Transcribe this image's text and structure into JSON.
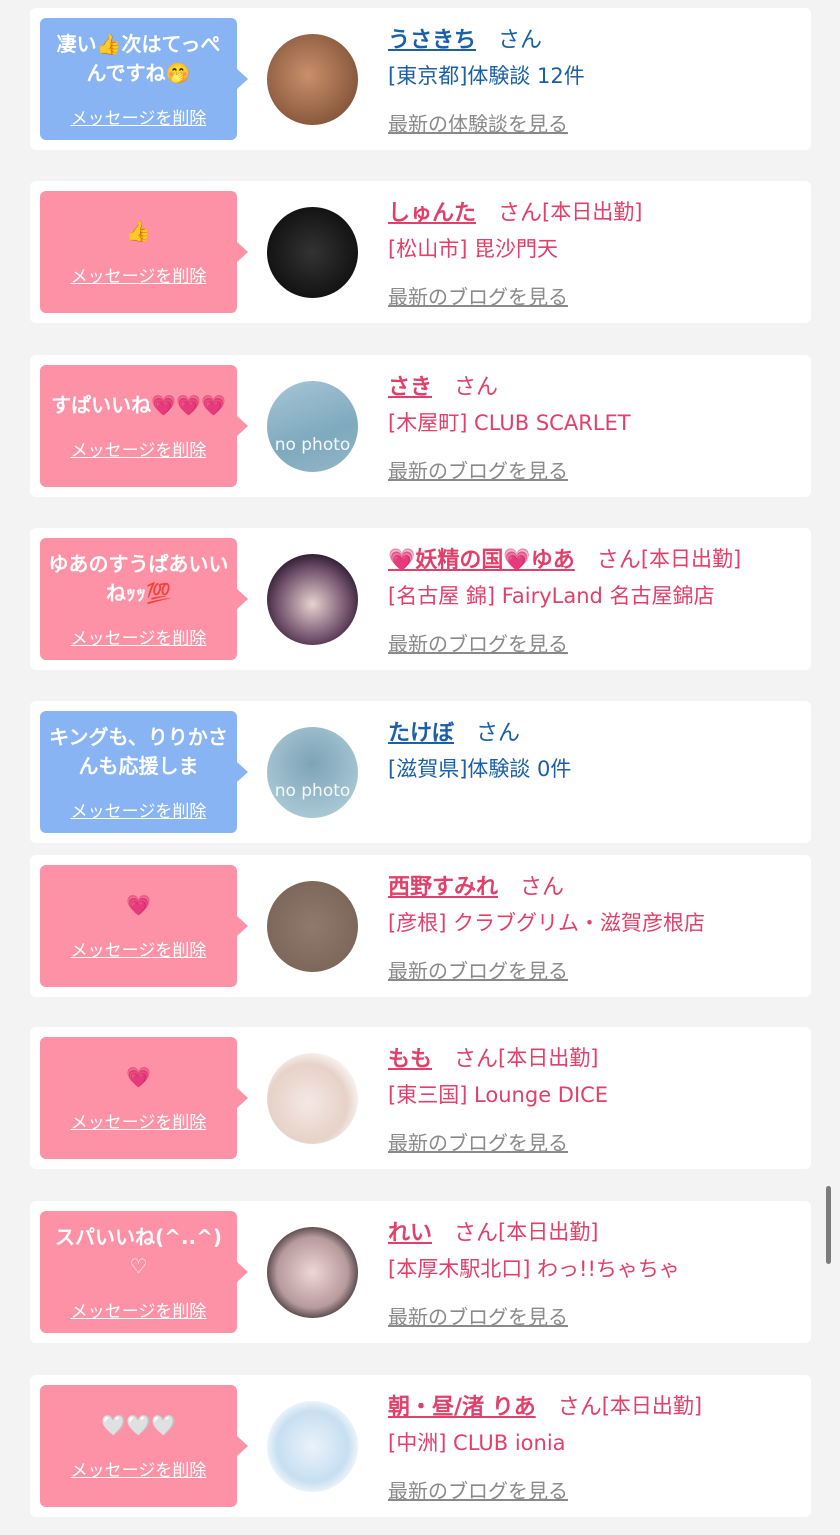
{
  "colors": {
    "background": "#f3f3f3",
    "bubble_blue": "#88b4f3",
    "bubble_pink": "#fd92a7",
    "text_blue": "#1b5fa8",
    "text_pink": "#e0406a",
    "link_gray": "#8a8a8a"
  },
  "entries": [
    {
      "theme": "blue",
      "message": "凄い👍次はてっぺんですね🤭",
      "delete_label": "メッセージを削除",
      "avatar": {
        "kind": "photo",
        "gradient": "radial-gradient(circle at 45% 45%, #c9906a, #8a5a3e 70%, #5b3a28)"
      },
      "name": "うさきち",
      "san": "さん",
      "status": "",
      "detail": "[東京都]体験談 12件",
      "more_label": "最新の体験談を見る"
    },
    {
      "theme": "pink",
      "message": "👍",
      "delete_label": "メッセージを削除",
      "avatar": {
        "kind": "logo",
        "gradient": "radial-gradient(circle at 50% 50%, #333, #111 75%)"
      },
      "name": "しゅんた",
      "san": "さん",
      "status": "[本日出勤]",
      "detail": "[松山市] 毘沙門天",
      "more_label": "最新のブログを見る"
    },
    {
      "theme": "pink",
      "message": "すぱいいね💗💗💗",
      "delete_label": "メッセージを削除",
      "avatar": {
        "kind": "nophoto",
        "text": "no photo",
        "gradient": "linear-gradient(160deg, #a6c6d6, #7fa9bd 60%, #93b6c6)"
      },
      "name": "さき",
      "san": "さん",
      "status": "",
      "detail": "[木屋町] CLUB SCARLET",
      "more_label": "最新のブログを見る"
    },
    {
      "theme": "pink",
      "message": "ゆあのすうぱあいいねｯｯ💯",
      "delete_label": "メッセージを削除",
      "avatar": {
        "kind": "photo",
        "gradient": "radial-gradient(circle at 50% 55%, #e8d2d0, #6b4a66 55%, #1d1320 80%)"
      },
      "name": "💗妖精の国💗ゆあ",
      "san": "さん",
      "status": "[本日出勤]",
      "detail": "[名古屋 錦] FairyLand 名古屋錦店",
      "more_label": "最新のブログを見る"
    },
    {
      "theme": "blue",
      "message": "キングも、りりかさんも応援しま",
      "delete_label": "メッセージを削除",
      "avatar": {
        "kind": "nophoto",
        "text": "no photo",
        "gradient": "radial-gradient(circle at 50% 40%, #7da4b6, #9fc0cf 60%, #b7d2dc)"
      },
      "name": "たけぼ",
      "san": "さん",
      "status": "",
      "detail": "[滋賀県]体験談 0件",
      "more_label": ""
    },
    {
      "theme": "pink",
      "message": "💗",
      "delete_label": "メッセージを削除",
      "avatar": {
        "kind": "logo",
        "gradient": "radial-gradient(circle, #8f7a6d, #7b6557 80%)"
      },
      "name": "西野すみれ",
      "san": "さん",
      "status": "",
      "detail": "[彦根] クラブグリム・滋賀彦根店",
      "more_label": "最新のブログを見る"
    },
    {
      "theme": "pink",
      "message": "💗",
      "delete_label": "メッセージを削除",
      "avatar": {
        "kind": "photo",
        "gradient": "radial-gradient(circle at 45% 55%, #f4e8e4, #e6d2c8 55%, #ffffff 80%)"
      },
      "name": "もも",
      "san": "さん",
      "status": "[本日出勤]",
      "detail": "[東三国] Lounge DICE",
      "more_label": "最新のブログを見る"
    },
    {
      "theme": "pink",
      "message": "スパいいね(^..^)♡",
      "delete_label": "メッセージを削除",
      "avatar": {
        "kind": "photo",
        "gradient": "radial-gradient(circle at 50% 50%, #efd6d6, #b79a9c 55%, #2b2326 80%)"
      },
      "name": "れい",
      "san": "さん",
      "status": "[本日出勤]",
      "detail": "[本厚木駅北口] わっ!!ちゃちゃ",
      "more_label": "最新のブログを見る"
    },
    {
      "theme": "pink",
      "message": "🤍🤍🤍",
      "delete_label": "メッセージを削除",
      "avatar": {
        "kind": "photo",
        "gradient": "radial-gradient(circle at 50% 50%, #eaf2fb, #c7dff1 55%, #ffffff 80%)"
      },
      "name": "朝・昼/渚 りあ",
      "san": "さん",
      "status": "[本日出勤]",
      "detail": "[中洲] CLUB ionia",
      "more_label": "最新のブログを見る"
    }
  ]
}
